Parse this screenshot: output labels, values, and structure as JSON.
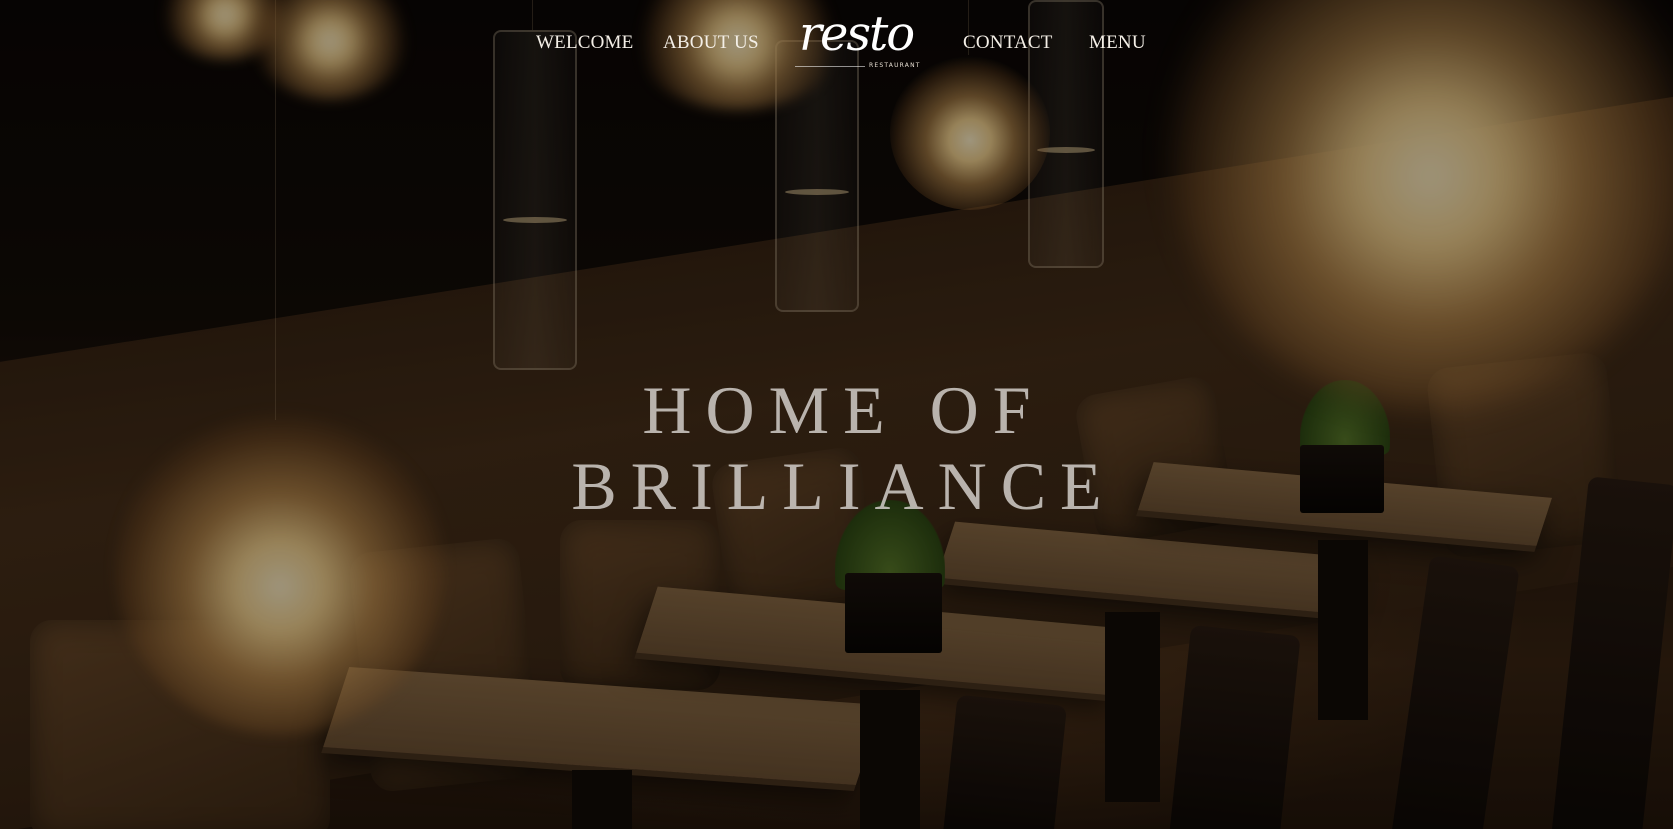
{
  "nav": {
    "left_links": [
      {
        "label": "WELCOME"
      },
      {
        "label": "ABOUT US"
      }
    ],
    "right_links": [
      {
        "label": "CONTACT"
      },
      {
        "label": "MENU"
      }
    ],
    "logo": {
      "wordmark": "resto",
      "tagline": "RESTAURANT"
    }
  },
  "hero": {
    "title_line_1": "HOME OF",
    "title_line_2": "BRILLIANCE"
  },
  "colors": {
    "nav_text": "#f4efe7",
    "hero_text": "#cdc8c4",
    "background": "#0c0806",
    "warm_light": "#ffdc96"
  }
}
